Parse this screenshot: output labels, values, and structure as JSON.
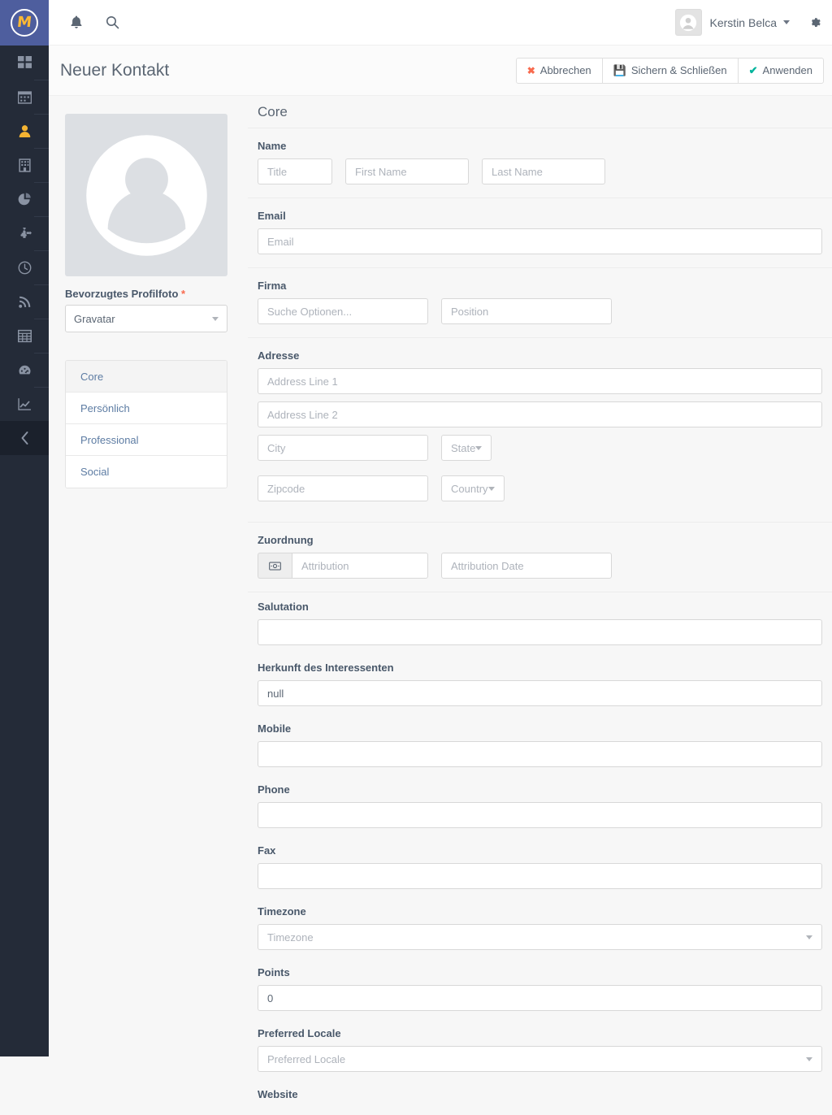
{
  "topbar": {
    "brand_letter": "M",
    "notifications_icon": "bell-icon",
    "search_icon": "search-icon",
    "user_name": "Kerstin Belca",
    "settings_icon": "gear-icon"
  },
  "leftnav": {
    "items": [
      {
        "name": "dashboard",
        "icon": "dashboard-icon"
      },
      {
        "name": "calendar",
        "icon": "calendar-icon"
      },
      {
        "name": "contacts",
        "icon": "user-icon",
        "active": true
      },
      {
        "name": "companies",
        "icon": "building-icon"
      },
      {
        "name": "segments",
        "icon": "pie-chart-icon"
      },
      {
        "name": "campaigns",
        "icon": "puzzle-icon"
      },
      {
        "name": "points",
        "icon": "clock-icon"
      },
      {
        "name": "channels",
        "icon": "rss-icon"
      },
      {
        "name": "components",
        "icon": "table-icon"
      },
      {
        "name": "stages",
        "icon": "gauge-icon"
      },
      {
        "name": "reports",
        "icon": "line-chart-icon"
      }
    ],
    "collapse_icon": "chevron-left-icon"
  },
  "header": {
    "title": "Neuer Kontakt",
    "buttons": [
      {
        "label": "Abbrechen",
        "icon": "x-icon"
      },
      {
        "label": "Sichern & Schließen",
        "icon": "save-icon"
      },
      {
        "label": "Anwenden",
        "icon": "check-icon"
      }
    ]
  },
  "left_panel": {
    "avatar_icon": "user-placeholder-icon",
    "profile_photo_label": "Bevorzugtes Profilfoto",
    "required_mark": "*",
    "profile_photo_value": "Gravatar",
    "tabs": [
      {
        "label": "Core",
        "active": true
      },
      {
        "label": "Persönlich",
        "active": false
      },
      {
        "label": "Professional",
        "active": false
      },
      {
        "label": "Social",
        "active": false
      }
    ]
  },
  "form": {
    "panel_title": "Core",
    "name": {
      "label": "Name",
      "title_placeholder": "Title",
      "first_placeholder": "First Name",
      "last_placeholder": "Last Name"
    },
    "email": {
      "label": "Email",
      "placeholder": "Email"
    },
    "company": {
      "label": "Firma",
      "company_placeholder": "Suche Optionen...",
      "position_placeholder": "Position"
    },
    "address": {
      "label": "Adresse",
      "line1_placeholder": "Address Line 1",
      "line2_placeholder": "Address Line 2",
      "city_placeholder": "City",
      "state_placeholder": "State",
      "zipcode_placeholder": "Zipcode",
      "country_placeholder": "Country"
    },
    "attribution": {
      "label": "Zuordnung",
      "addon_icon": "money-icon",
      "attribution_placeholder": "Attribution",
      "date_placeholder": "Attribution Date"
    },
    "salutation": {
      "label": "Salutation",
      "value": ""
    },
    "lead_source": {
      "label": "Herkunft des Interessenten",
      "value": "null"
    },
    "mobile": {
      "label": "Mobile",
      "value": ""
    },
    "phone": {
      "label": "Phone",
      "value": ""
    },
    "fax": {
      "label": "Fax",
      "value": ""
    },
    "timezone": {
      "label": "Timezone",
      "placeholder": "Timezone"
    },
    "points": {
      "label": "Points",
      "value": "0"
    },
    "locale": {
      "label": "Preferred Locale",
      "placeholder": "Preferred Locale"
    },
    "website": {
      "label": "Website"
    }
  },
  "colors": {
    "brand_blue": "#4e5e9e",
    "brand_yellow": "#fdb933",
    "nav_dark": "#242b38",
    "accent_red": "#f86b4f",
    "accent_green": "#00b49c",
    "link_blue": "#5d7ca3"
  }
}
